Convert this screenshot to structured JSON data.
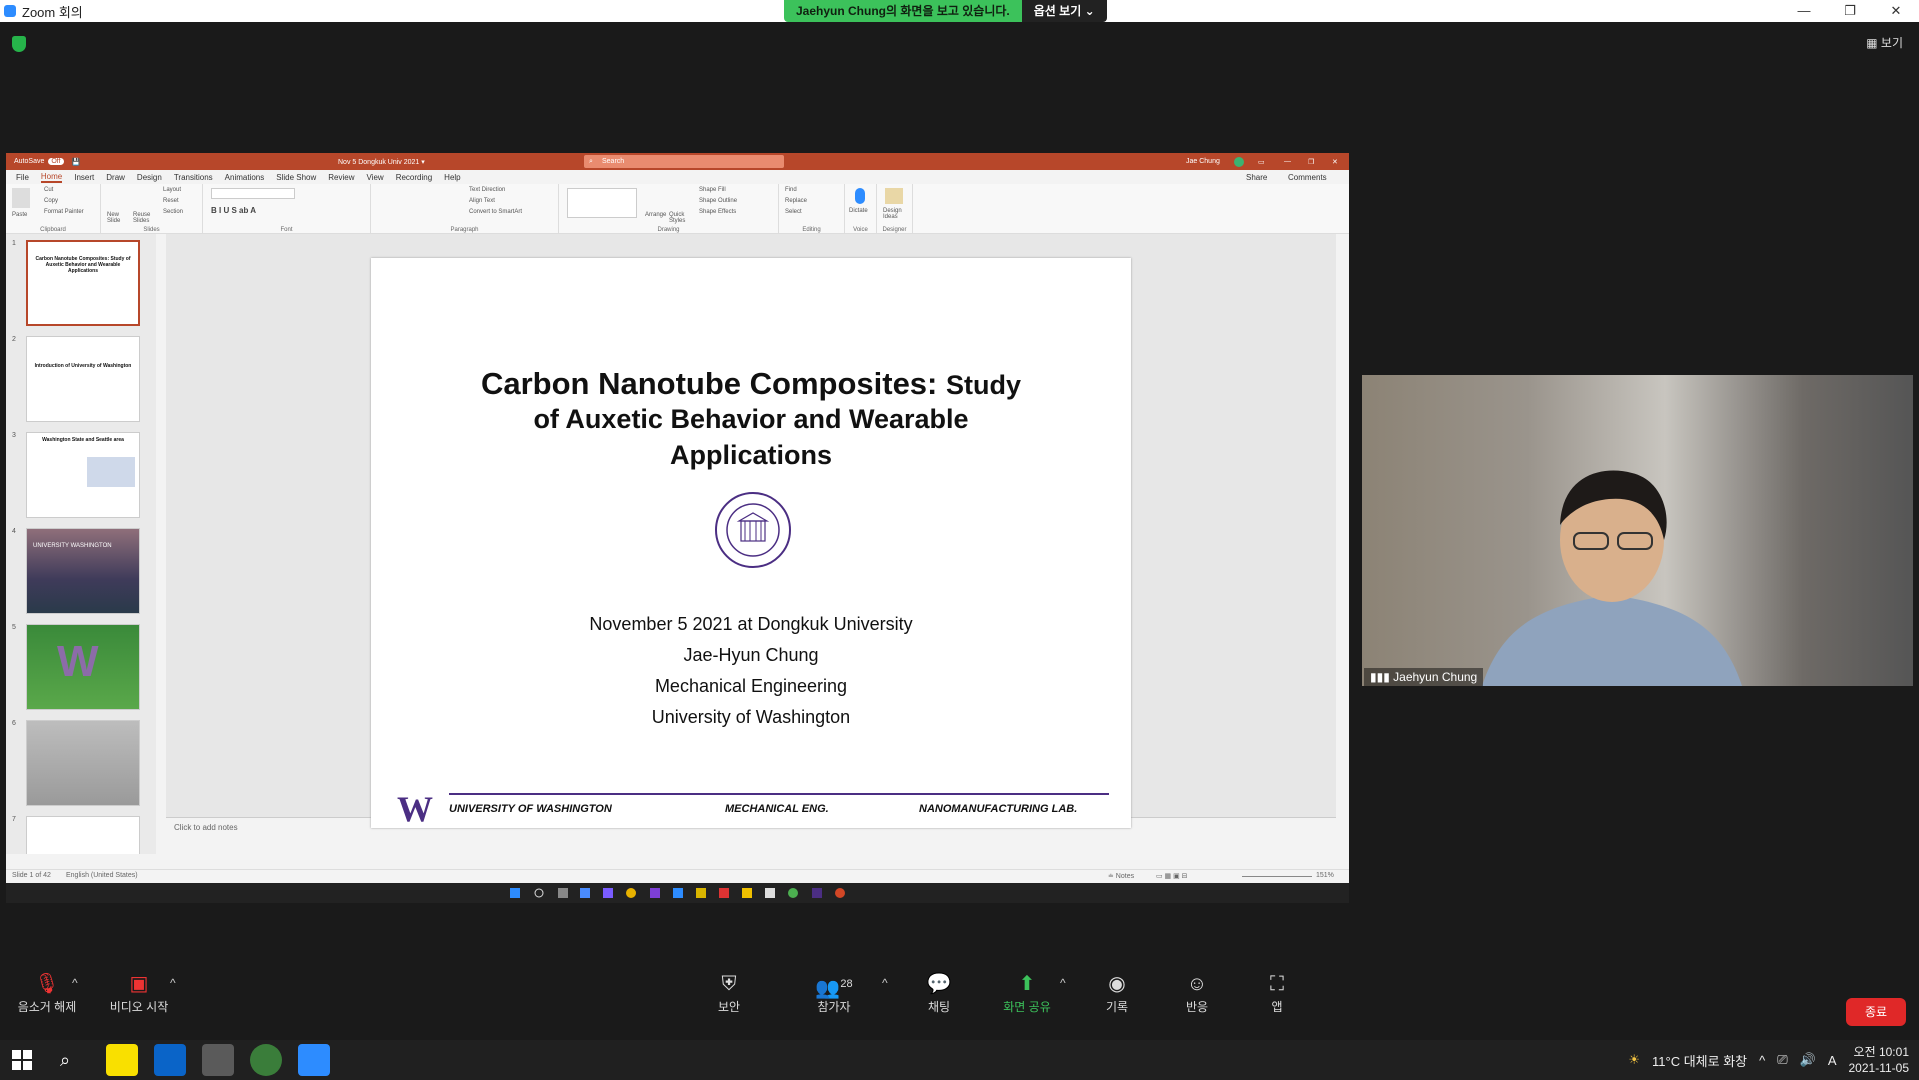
{
  "zoom": {
    "title": "Zoom 회의",
    "share_message": "Jaehyun Chung의 화면을 보고 있습니다.",
    "view_options": "옵션 보기 ⌄",
    "view_button": "▦ 보기",
    "participant_name": "Jaehyun Chung",
    "controls": {
      "mute": "음소거 해제",
      "video": "비디오 시작",
      "security": "보안",
      "participants": "참가자",
      "participants_count": "28",
      "chat": "채팅",
      "share": "화면 공유",
      "record": "기록",
      "reactions": "반응",
      "apps": "앱",
      "end": "종료"
    }
  },
  "ppt": {
    "autosave": "AutoSave",
    "autosave_state": "Off",
    "doc_title": "Nov 5 Dongkuk Univ 2021 ▾",
    "search_placeholder": "Search",
    "user": "Jae Chung",
    "share": "Share",
    "comments": "Comments",
    "tabs": [
      "File",
      "Home",
      "Insert",
      "Draw",
      "Design",
      "Transitions",
      "Animations",
      "Slide Show",
      "Review",
      "View",
      "Recording",
      "Help"
    ],
    "ribbon_groups": [
      "Clipboard",
      "Slides",
      "Font",
      "Paragraph",
      "Drawing",
      "Editing",
      "Voice",
      "Designer"
    ],
    "ribbon_items": {
      "paste": "Paste",
      "cut": "Cut",
      "copy": "Copy",
      "format_painter": "Format Painter",
      "new_slide": "New Slide",
      "reuse_slides": "Reuse Slides",
      "layout": "Layout",
      "reset": "Reset",
      "section": "Section",
      "text_direction": "Text Direction",
      "align_text": "Align Text",
      "convert_smartart": "Convert to SmartArt",
      "arrange": "Arrange",
      "quick_styles": "Quick Styles",
      "shape_fill": "Shape Fill",
      "shape_outline": "Shape Outline",
      "shape_effects": "Shape Effects",
      "find": "Find",
      "replace": "Replace",
      "select": "Select",
      "dictate": "Dictate",
      "design_ideas": "Design Ideas"
    },
    "thumbnails": [
      {
        "num": "1",
        "title": "Carbon Nanotube Composites: Study of Auxetic Behavior and Wearable Applications"
      },
      {
        "num": "2",
        "title": "Introduction of University of Washington"
      },
      {
        "num": "3",
        "title": "Washington State and Seattle area"
      },
      {
        "num": "4",
        "title": "UNIVERSITY WASHINGTON"
      },
      {
        "num": "5",
        "title": ""
      },
      {
        "num": "6",
        "title": ""
      },
      {
        "num": "7",
        "title": ""
      }
    ],
    "slide": {
      "title_big": "Carbon Nanotube Composites:",
      "title_study": "Study",
      "title_line2": "of Auxetic Behavior and Wearable",
      "title_line3": "Applications",
      "date_line": "November 5 2021 at Dongkuk University",
      "author": "Jae-Hyun Chung",
      "dept": "Mechanical Engineering",
      "univ": "University of Washington",
      "footer_univ": "UNIVERSITY OF WASHINGTON",
      "footer_dept": "MECHANICAL ENG.",
      "footer_lab": "NANOMANUFACTURING LAB.",
      "footer_logo": "W"
    },
    "notes_placeholder": "Click to add notes",
    "status_slide": "Slide 1 of 42",
    "status_lang": "English (United States)",
    "status_notes": "≐ Notes",
    "zoom_level": "151%"
  },
  "tray": {
    "weather": "11°C  대체로 화창",
    "ime": "A",
    "time": "오전 10:01",
    "date": "2021-11-05"
  },
  "colors": {
    "ppt_accent": "#b7472a",
    "zoom_green": "#3cc25b",
    "end_red": "#e02828",
    "uw_purple": "#4b2e83"
  }
}
